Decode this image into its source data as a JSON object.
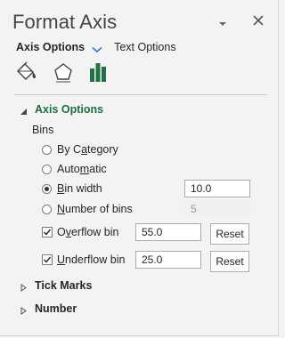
{
  "pane": {
    "title": "Format Axis"
  },
  "option_tabs": {
    "axis_options": "Axis Options",
    "text_options": "Text Options"
  },
  "icon_tabs": [
    {
      "icon": "fill-bucket-icon"
    },
    {
      "icon": "pentagon-effects-icon"
    },
    {
      "icon": "bar-chart-icon",
      "active": true
    }
  ],
  "axis_options_section": {
    "label": "Axis Options",
    "expanded": true,
    "bins_label": "Bins",
    "radios": [
      {
        "label_pre": "By C",
        "accel": "a",
        "label_post": "tegory",
        "checked": false
      },
      {
        "label_pre": "Auto",
        "accel": "m",
        "label_post": "atic",
        "checked": false
      },
      {
        "label_pre": "",
        "accel": "B",
        "label_post": "in width",
        "checked": true,
        "value": "10.0"
      },
      {
        "label_pre": "",
        "accel": "N",
        "label_post": "umber of bins",
        "checked": false,
        "value": "5"
      }
    ],
    "overflow": {
      "label_pre": "O",
      "accel": "v",
      "label_post": "erflow bin",
      "checked": true,
      "value": "55.0",
      "reset": "Reset"
    },
    "underflow": {
      "label_pre": "",
      "accel": "U",
      "label_post": "nderflow bin",
      "checked": true,
      "value": "25.0",
      "reset": "Reset"
    }
  },
  "collapsed_sections": [
    {
      "label": "Tick Marks"
    },
    {
      "label": "Number"
    }
  ],
  "colors": {
    "background": "#f3f3f3",
    "accent_green": "#1f6e43",
    "bar_icon_green": "#217346"
  }
}
